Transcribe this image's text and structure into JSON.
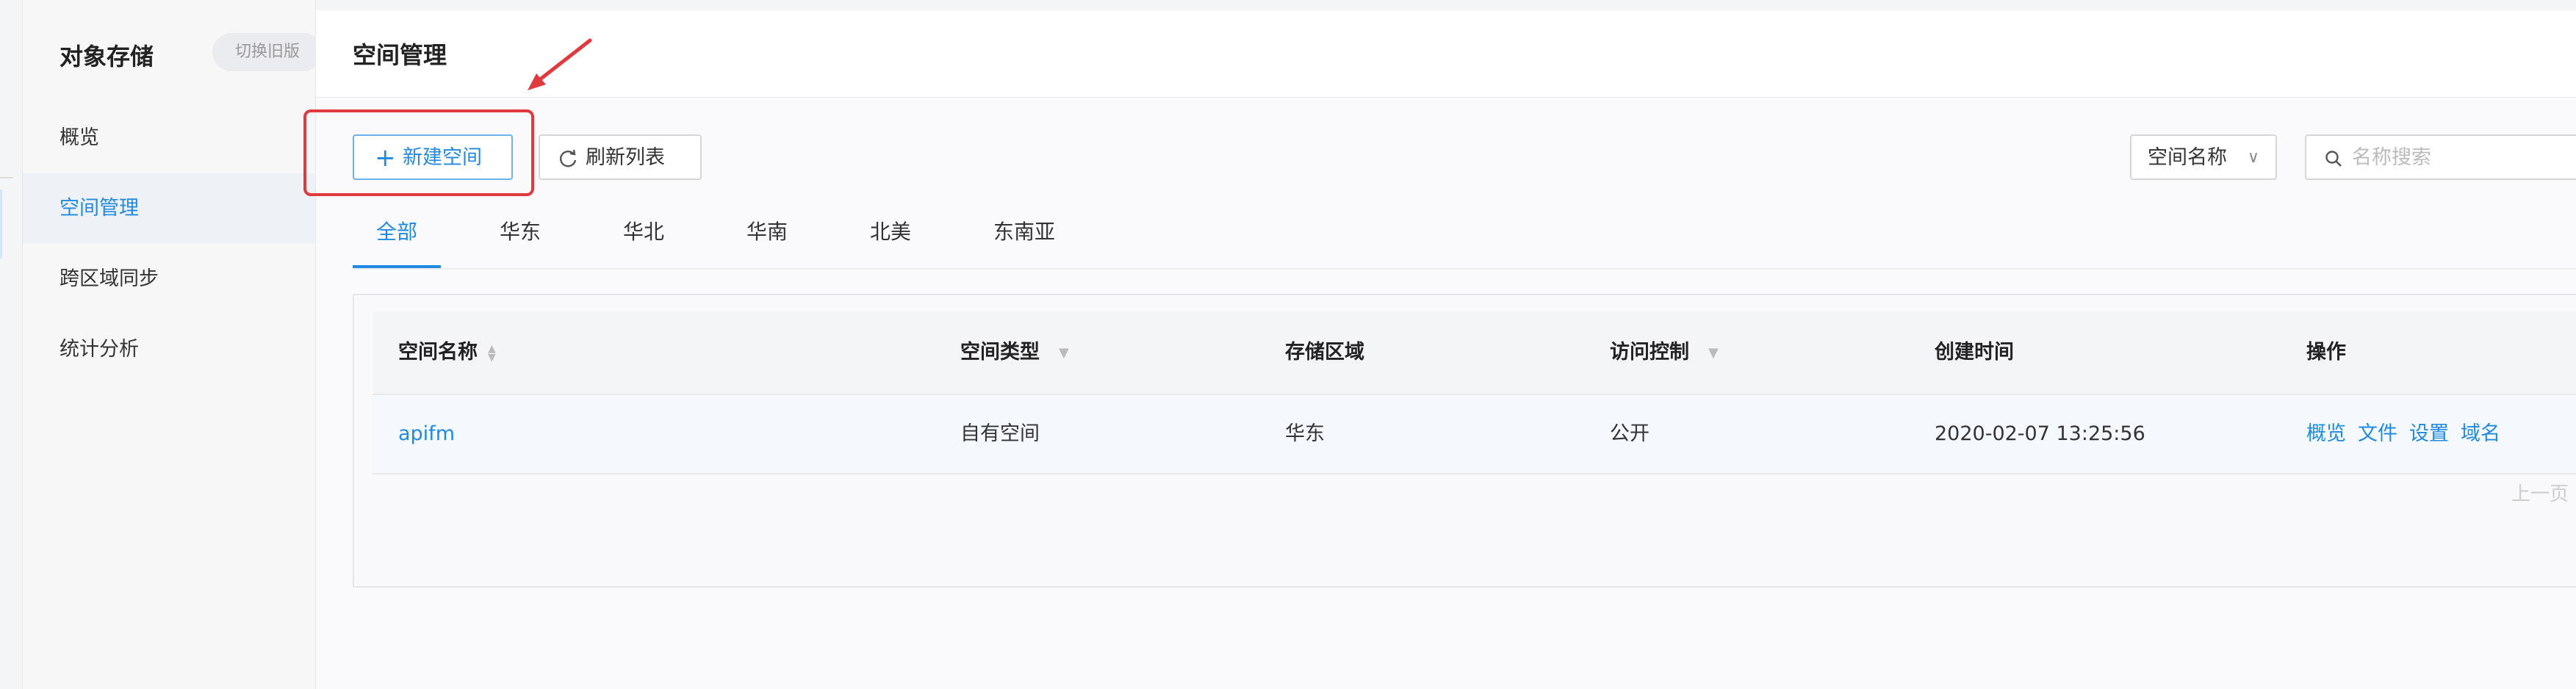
{
  "sidebar": {
    "brand": "对象存储",
    "switch_label": "切换旧版",
    "items": [
      {
        "label": "概览",
        "active": false
      },
      {
        "label": "空间管理",
        "active": true
      },
      {
        "label": "跨区域同步",
        "active": false
      },
      {
        "label": "统计分析",
        "active": false
      }
    ]
  },
  "header": {
    "title": "空间管理"
  },
  "toolbar": {
    "new_label": "新建空间",
    "refresh_label": "刷新列表",
    "select_value": "空间名称",
    "search_placeholder": "名称搜索"
  },
  "tabs": [
    "全部",
    "华东",
    "华北",
    "华南",
    "北美",
    "东南亚"
  ],
  "table": {
    "headers": [
      "空间名称",
      "空间类型",
      "存储区域",
      "访问控制",
      "创建时间",
      "操作"
    ],
    "rows": [
      {
        "name": "apifm",
        "type": "自有空间",
        "region": "华东",
        "access": "公开",
        "created": "2020-02-07 13:25:56",
        "actions": [
          "概览",
          "文件",
          "设置",
          "域名"
        ]
      }
    ]
  },
  "pager": {
    "prev_label": "上一页"
  },
  "colors": {
    "accent": "#1f8ae0",
    "highlight": "#e0393e"
  }
}
